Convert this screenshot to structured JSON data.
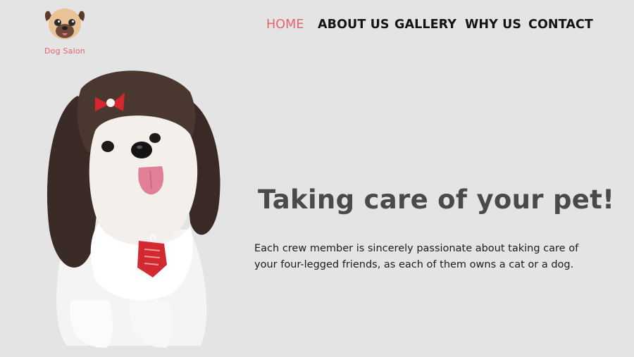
{
  "brand": {
    "name": "Dog Salon",
    "accent_color": "#e6636b",
    "logo_icon": "pug-face-icon"
  },
  "nav": {
    "items": [
      {
        "label": "HOME",
        "active": true
      },
      {
        "label": "ABOUT US",
        "active": false
      },
      {
        "label": "GALLERY",
        "active": false
      },
      {
        "label": "WHY US",
        "active": false
      },
      {
        "label": "CONTACT",
        "active": false
      }
    ]
  },
  "hero": {
    "title": "Taking care of your pet!",
    "body_lines": [
      "Each crew member is sincerely passionate about taking care of",
      "your four-legged friends, as each of them owns a cat or a dog."
    ],
    "image_icon": "shih-tzu-dog-photo"
  },
  "colors": {
    "background": "#e4e4e4",
    "title": "#4a4a4a",
    "nav_text": "#141414"
  }
}
